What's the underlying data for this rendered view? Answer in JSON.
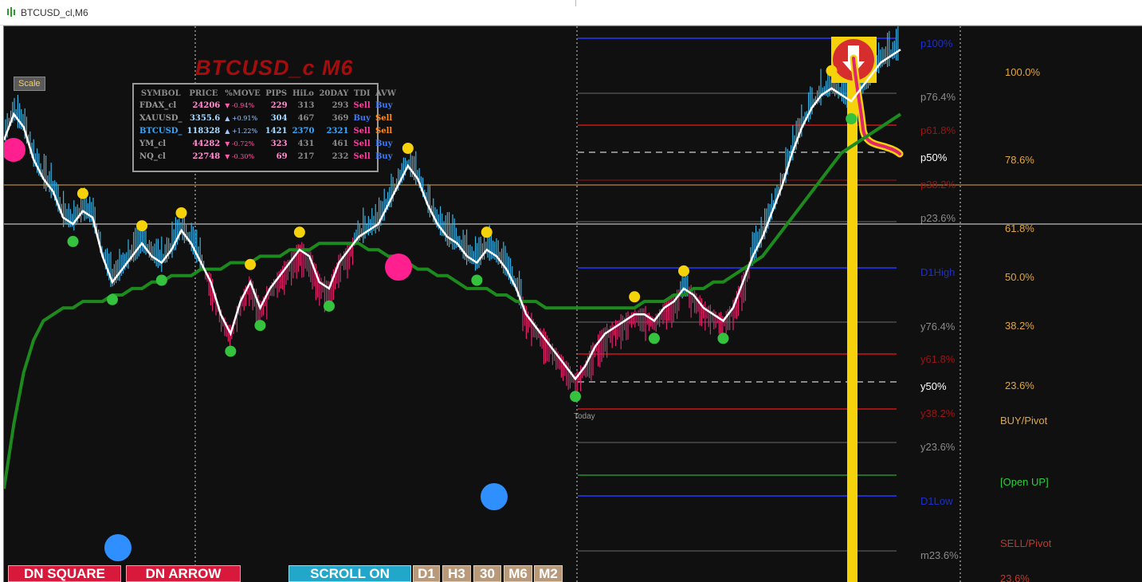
{
  "window": {
    "title": "BTCUSD_cl,M6"
  },
  "chart_title": "BTCUSD_c M6",
  "scale_button": "Scale",
  "today_label": "Today",
  "dashboard": {
    "headers": [
      "SYMBOL",
      "PRICE",
      "%MOVE",
      "PIPS",
      "HiLo",
      "20DAY",
      "TDI",
      "AVW"
    ],
    "rows": [
      {
        "symbol": "FDAX_cl",
        "price": "24206",
        "move": "▼ -0.94%",
        "pips": "229",
        "hilo": "313",
        "day20": "293",
        "tdi": "Sell",
        "avw": "Buy",
        "dir": "down"
      },
      {
        "symbol": "XAUUSD_",
        "price": "3355.6",
        "move": "▲ +0.91%",
        "pips": "304",
        "hilo": "467",
        "day20": "369",
        "tdi": "Buy",
        "avw": "Sell",
        "dir": "up"
      },
      {
        "symbol": "BTCUSD_",
        "price": "118328",
        "move": "▲ +1.22%",
        "pips": "1421",
        "hilo": "2370",
        "day20": "2321",
        "tdi": "Sell",
        "avw": "Sell",
        "dir": "up",
        "highlight": true
      },
      {
        "symbol": "YM_cl",
        "price": "44282",
        "move": "▼ -0.72%",
        "pips": "323",
        "hilo": "431",
        "day20": "461",
        "tdi": "Sell",
        "avw": "Buy",
        "dir": "down"
      },
      {
        "symbol": "NQ_cl",
        "price": "22748",
        "move": "▼ -0.30%",
        "pips": "69",
        "hilo": "217",
        "day20": "232",
        "tdi": "Sell",
        "avw": "Buy",
        "dir": "down"
      }
    ]
  },
  "levels_mid": [
    {
      "label": "p100%",
      "color": "#1f2fc8"
    },
    {
      "label": "p76.4%",
      "color": "#8a8a8a"
    },
    {
      "label": "p61.8%",
      "color": "#9c1414"
    },
    {
      "label": "p50%",
      "color": "#ffffff"
    },
    {
      "label": "p38.2%",
      "color": "#9c1414"
    },
    {
      "label": "p23.6%",
      "color": "#8a8a8a"
    },
    {
      "label": "D1High",
      "color": "#1f2fc8"
    },
    {
      "label": "y76.4%",
      "color": "#8a8a8a"
    },
    {
      "label": "y61.8%",
      "color": "#9c1414"
    },
    {
      "label": "y50%",
      "color": "#ffffff"
    },
    {
      "label": "y38.2%",
      "color": "#9c1414"
    },
    {
      "label": "y23.6%",
      "color": "#8a8a8a"
    },
    {
      "label": "D1Low",
      "color": "#1f2fc8"
    },
    {
      "label": "m23.6%",
      "color": "#8a8a8a"
    }
  ],
  "levels_right": [
    {
      "label": "100.0%",
      "color": "#e0a640"
    },
    {
      "label": "78.6%",
      "color": "#e0a640"
    },
    {
      "label": "61.8%",
      "color": "#e0a640"
    },
    {
      "label": "50.0%",
      "color": "#e0a640"
    },
    {
      "label": "38.2%",
      "color": "#e0a640"
    },
    {
      "label": "23.6%",
      "color": "#e0a640"
    },
    {
      "label": "BUY/Pivot",
      "color": "#e0a640"
    },
    {
      "label": "[Open UP]",
      "color": "#2ecc40"
    },
    {
      "label": "SELL/Pivot",
      "color": "#c0392b"
    },
    {
      "label": "23.6%",
      "color": "#c0392b"
    }
  ],
  "buttons": {
    "dn_square": "DN SQUARE",
    "dn_arrow": "DN ARROW",
    "scroll": "SCROLL ON",
    "d1": "D1",
    "h3": "H3",
    "m30": "30",
    "m6": "M6",
    "m2": "M2"
  },
  "colors": {
    "background": "#101010",
    "price_up": "#3ab4e6",
    "price_down": "#e0246e",
    "fast_line": "#ffffff",
    "slow_line": "#1d8a1d",
    "marker_high": "#f5d20a",
    "marker_low": "#35c23e",
    "extreme_high": "#ff1f8f",
    "extreme_low": "#2f8fff",
    "signal_bar": "#f5d20a"
  },
  "chart_data": {
    "type": "line",
    "title": "BTCUSD_c M6",
    "timeframe": "M6",
    "series": [
      {
        "name": "",
        "values": [
          114,
          118,
          116,
          111,
          108,
          106,
          102,
          101,
          103,
          102,
          96,
          92,
          94,
          96,
          98,
          96,
          95,
          97,
          100,
          98,
          95,
          92,
          87,
          84,
          89,
          92,
          88,
          91,
          93,
          95,
          97,
          96,
          92,
          91,
          95,
          97,
          99,
          100,
          101,
          104,
          107,
          110,
          108,
          104,
          101,
          99,
          98,
          96,
          95,
          97,
          96,
          94,
          91,
          87,
          85,
          83,
          81,
          79,
          77,
          79,
          82,
          84,
          85,
          86,
          87,
          87,
          86,
          88,
          89,
          91,
          90,
          88,
          87,
          86,
          88,
          92,
          96,
          99,
          103,
          107,
          112,
          116,
          119,
          121,
          122,
          121,
          120,
          122,
          124,
          126,
          127,
          128
        ]
      },
      {
        "name": "",
        "values": [
          60,
          70,
          78,
          83,
          86,
          87,
          88,
          88,
          89,
          89,
          89,
          90,
          90,
          91,
          91,
          92,
          92,
          93,
          93,
          93,
          94,
          94,
          94,
          95,
          95,
          95,
          96,
          96,
          96,
          97,
          97,
          97,
          98,
          98,
          98,
          98,
          98,
          97,
          97,
          96,
          96,
          95,
          94,
          94,
          93,
          93,
          92,
          91,
          91,
          91,
          90,
          90,
          89,
          89,
          89,
          88,
          88,
          88,
          88,
          88,
          88,
          88,
          88,
          88,
          88,
          89,
          89,
          89,
          90,
          90,
          91,
          91,
          92,
          92,
          93,
          94,
          95,
          96,
          98,
          100,
          102,
          104,
          106,
          108,
          110,
          112,
          113,
          114,
          115,
          116,
          117,
          118
        ]
      }
    ]
  }
}
